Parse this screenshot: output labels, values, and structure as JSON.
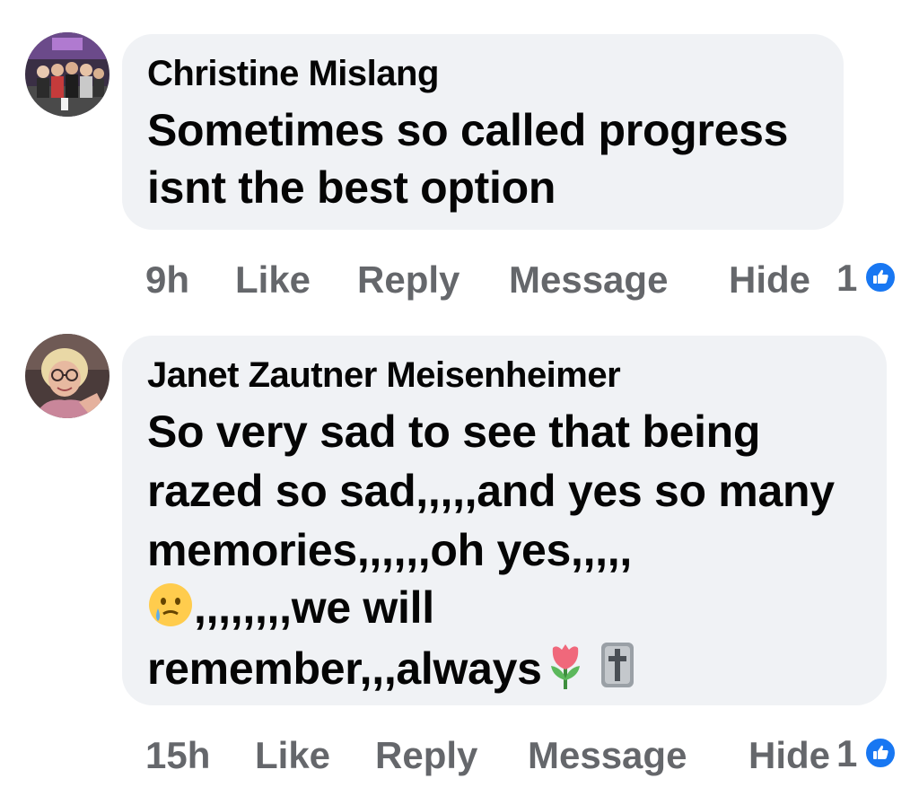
{
  "comments": [
    {
      "author": "Christine Mislang",
      "lines": [
        "Sometimes so called progress",
        "isnt the best option"
      ],
      "time": "9h",
      "like_label": "Like",
      "reply_label": "Reply",
      "message_label": "Message",
      "hide_label": "Hide",
      "reaction_count": "1",
      "reaction_icon": "thumbs-up-icon"
    },
    {
      "author": "Janet Zautner Meisenheimer",
      "lines": [
        "So very sad to see that being",
        "razed so sad,,,,,and yes so many",
        "memories,,,,,,oh yes,,,,,",
        ",,,,,,,,we will",
        "remember,,,always"
      ],
      "emojis": [
        "crying-face-emoji",
        "tulip-emoji",
        "cross-emoji"
      ],
      "time": "15h",
      "like_label": "Like",
      "reply_label": "Reply",
      "message_label": "Message",
      "hide_label": "Hide",
      "reaction_count": "1",
      "reaction_icon": "thumbs-up-icon"
    }
  ],
  "colors": {
    "bubble": "#f0f2f5",
    "text": "#050505",
    "meta": "#65676b",
    "like_badge": "#1877f2"
  }
}
